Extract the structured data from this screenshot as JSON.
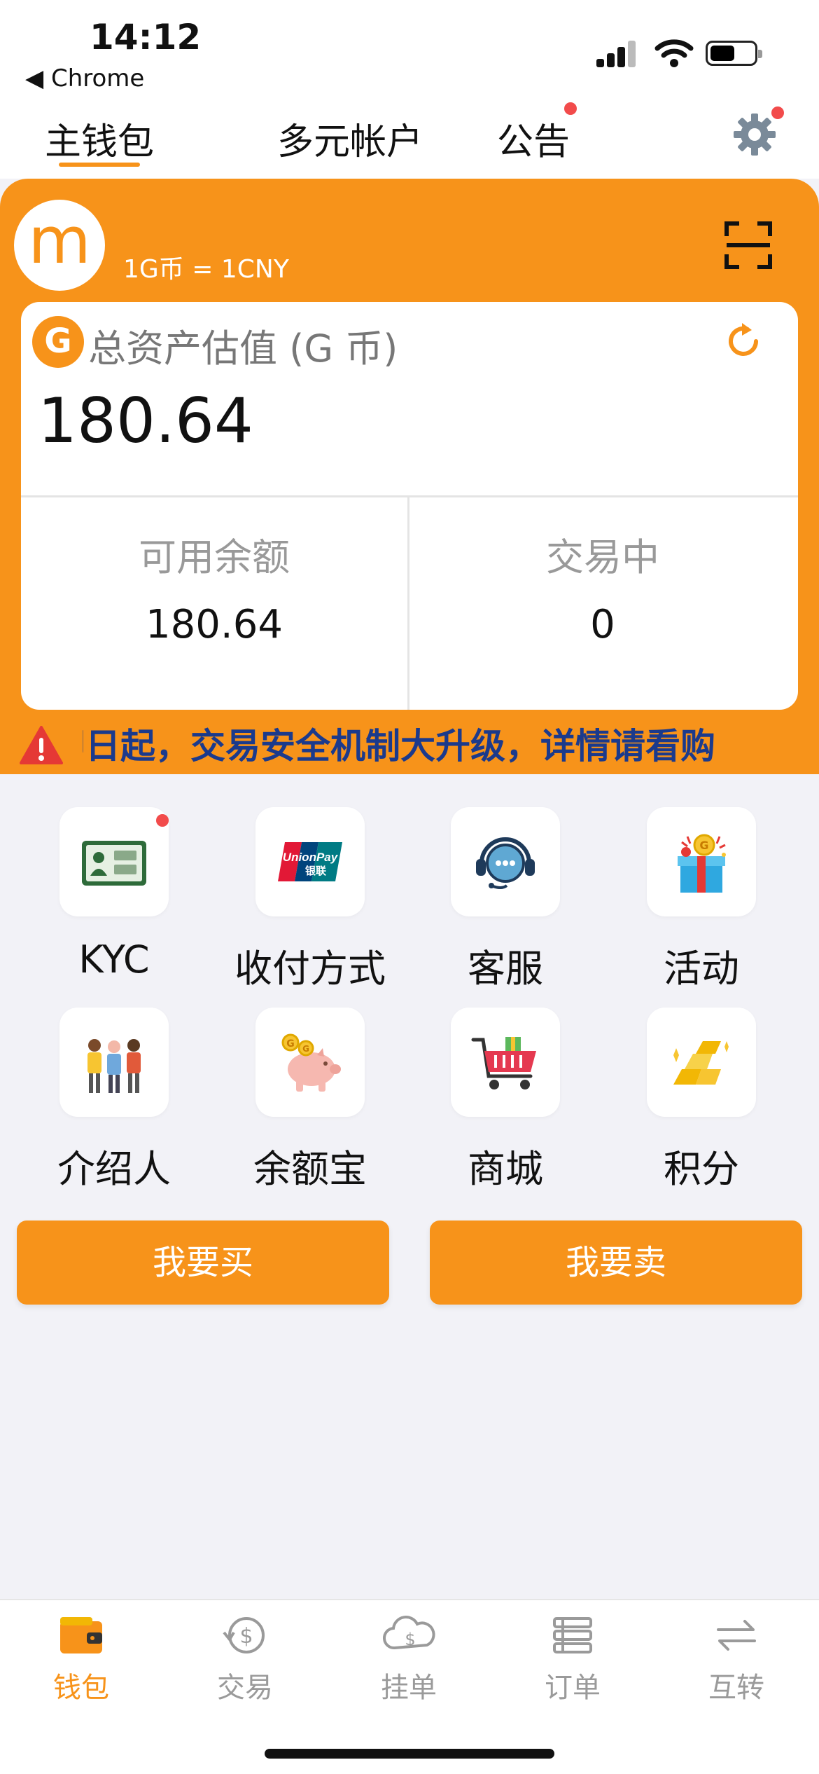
{
  "status_bar": {
    "time": "14:12",
    "back_app": "◀ Chrome"
  },
  "top_tabs": [
    {
      "label": "主钱包",
      "active": true
    },
    {
      "label": "多元帐户",
      "active": false
    },
    {
      "label": "公告",
      "active": false,
      "badge": true
    }
  ],
  "wallet": {
    "logo_letter": "m",
    "rate": "1G币 = 1CNY",
    "coin_symbol": "G",
    "total_label": "总资产估值 (G 币)",
    "total_value": "180.64",
    "available_label": "可用余额",
    "available_value": "180.64",
    "trading_label": "交易中",
    "trading_value": "0",
    "notice": "即日起，交易安全机制大升级，详情请看购"
  },
  "grid": [
    {
      "label": "KYC",
      "icon": "id-card-icon",
      "badge": true
    },
    {
      "label": "收付方式",
      "icon": "unionpay-icon"
    },
    {
      "label": "客服",
      "icon": "customer-service-icon"
    },
    {
      "label": "活动",
      "icon": "gift-icon"
    },
    {
      "label": "介绍人",
      "icon": "people-icon"
    },
    {
      "label": "余额宝",
      "icon": "piggy-bank-icon"
    },
    {
      "label": "商城",
      "icon": "shopping-cart-icon"
    },
    {
      "label": "积分",
      "icon": "gold-bars-icon"
    }
  ],
  "unionpay_text": "UnionPay",
  "unionpay_sub": "银联",
  "actions": {
    "buy": "我要买",
    "sell": "我要卖"
  },
  "bottom_nav": [
    {
      "label": "钱包",
      "icon": "wallet-icon",
      "active": true
    },
    {
      "label": "交易",
      "icon": "dollar-exchange-icon"
    },
    {
      "label": "挂单",
      "icon": "cloud-dollar-icon"
    },
    {
      "label": "订单",
      "icon": "list-icon"
    },
    {
      "label": "互转",
      "icon": "transfer-arrows-icon"
    }
  ],
  "colors": {
    "brand": "#f7931a",
    "badge": "#f24b4b",
    "notice_text": "#1b3a8c"
  }
}
